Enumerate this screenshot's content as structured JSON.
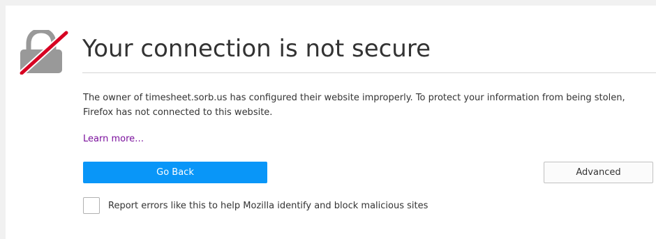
{
  "error_page": {
    "icon": "broken-lock-icon",
    "title": "Your connection is not secure",
    "description": "The owner of timesheet.sorb.us has configured their website improperly. To protect your information from being stolen, Firefox has not connected to this website.",
    "learn_more_label": "Learn more…",
    "go_back_label": "Go Back",
    "advanced_label": "Advanced",
    "report_checkbox": {
      "label": "Report errors like this to help Mozilla identify and block malicious sites",
      "checked": false
    }
  },
  "colors": {
    "primary_button": "#0996f8",
    "link": "#7a0f9c",
    "icon_lock": "#999999",
    "icon_slash": "#d70022"
  }
}
